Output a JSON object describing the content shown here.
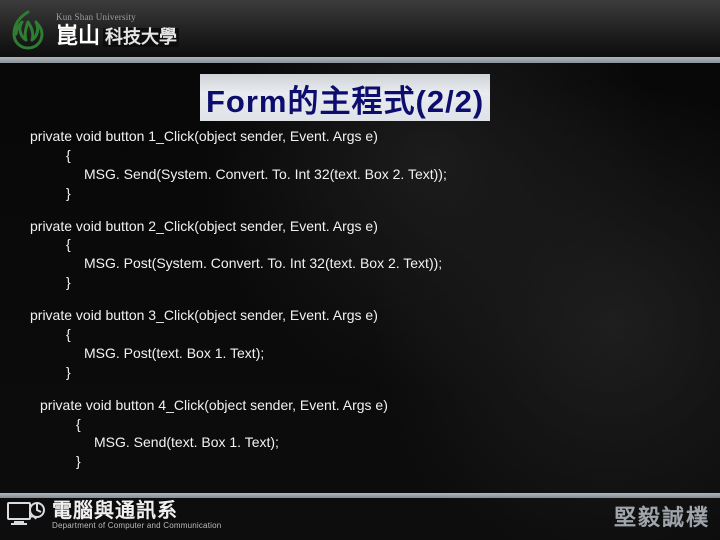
{
  "header": {
    "university_en": "Kun Shan University",
    "university_cn_bold": "崑山",
    "university_cn_rest": "科技大學"
  },
  "title": "Form的主程式(2/2)",
  "code": {
    "blocks": [
      {
        "signature": "private void button 1_Click(object sender, Event. Args e)",
        "body": "MSG. Send(System. Convert. To. Int 32(text. Box 2. Text));",
        "indent": false
      },
      {
        "signature": "private void button 2_Click(object sender, Event. Args e)",
        "body": "MSG. Post(System. Convert. To. Int 32(text. Box 2. Text));",
        "indent": false
      },
      {
        "signature": "private void button 3_Click(object sender, Event. Args e)",
        "body": "MSG. Post(text. Box 1. Text);",
        "indent": false
      },
      {
        "signature": "private void button 4_Click(object sender, Event. Args e)",
        "body": "MSG. Send(text. Box 1. Text);",
        "indent": true
      }
    ],
    "brace_open": "{",
    "brace_close": "}"
  },
  "footer": {
    "dept_cn": "電腦與通訊系",
    "dept_en": "Department of Computer and Communication",
    "motto": "堅毅誠樸"
  }
}
